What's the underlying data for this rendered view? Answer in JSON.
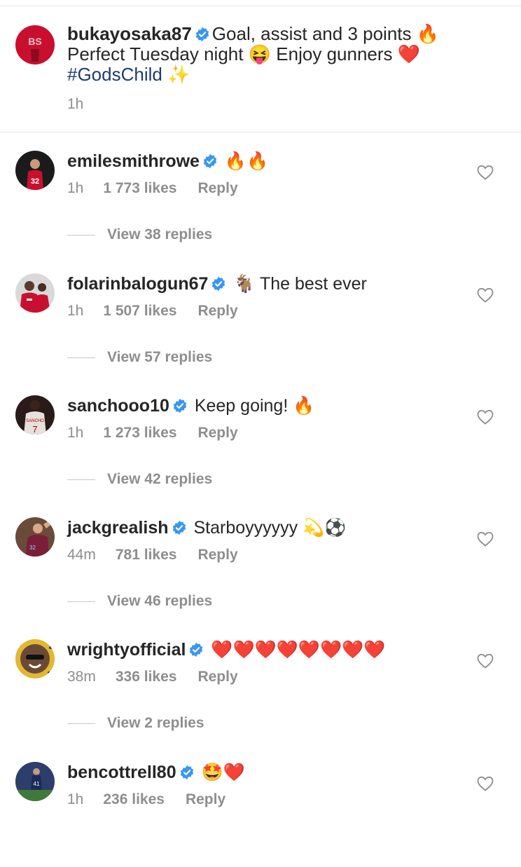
{
  "caption": {
    "username": "bukayosaka87",
    "text1": "Goal, assist and 3 points 🔥",
    "text2": "Perfect Tuesday night 😝 Enjoy gunners ❤️",
    "hashtag": "#GodsChild",
    "hashtag_emoji": "✨",
    "time": "1h"
  },
  "comments": [
    {
      "username": "emilesmithrowe",
      "text": "🔥🔥",
      "time": "1h",
      "likes": "1 773 likes",
      "reply": "Reply",
      "view_replies": "View 38 replies",
      "avatar_color": "#c8102e"
    },
    {
      "username": "folarinbalogun67",
      "text": "🐐 The best ever",
      "time": "1h",
      "likes": "1 507 likes",
      "reply": "Reply",
      "view_replies": "View 57 replies",
      "avatar_color": "#c8102e"
    },
    {
      "username": "sanchooo10",
      "text": "Keep going! 🔥",
      "time": "1h",
      "likes": "1 273 likes",
      "reply": "Reply",
      "view_replies": "View 42 replies",
      "avatar_color": "#8a1c22"
    },
    {
      "username": "jackgrealish",
      "text": "Starboyyyyyy 💫⚽",
      "time": "44m",
      "likes": "781 likes",
      "reply": "Reply",
      "view_replies": "View 46 replies",
      "avatar_color": "#7a1e3a"
    },
    {
      "username": "wrightyofficial",
      "text": "❤️❤️❤️❤️❤️❤️❤️❤️",
      "time": "38m",
      "likes": "336 likes",
      "reply": "Reply",
      "view_replies": "View 2 replies",
      "avatar_color": "#c9a227"
    },
    {
      "username": "bencottrell80",
      "text": "🤩❤️",
      "time": "1h",
      "likes": "236 likes",
      "reply": "Reply",
      "view_replies": "",
      "avatar_color": "#1c2a5a"
    }
  ],
  "colors": {
    "verified": "#3897f0",
    "muted": "#8e8e8e",
    "hashtag": "#1f3b71"
  }
}
